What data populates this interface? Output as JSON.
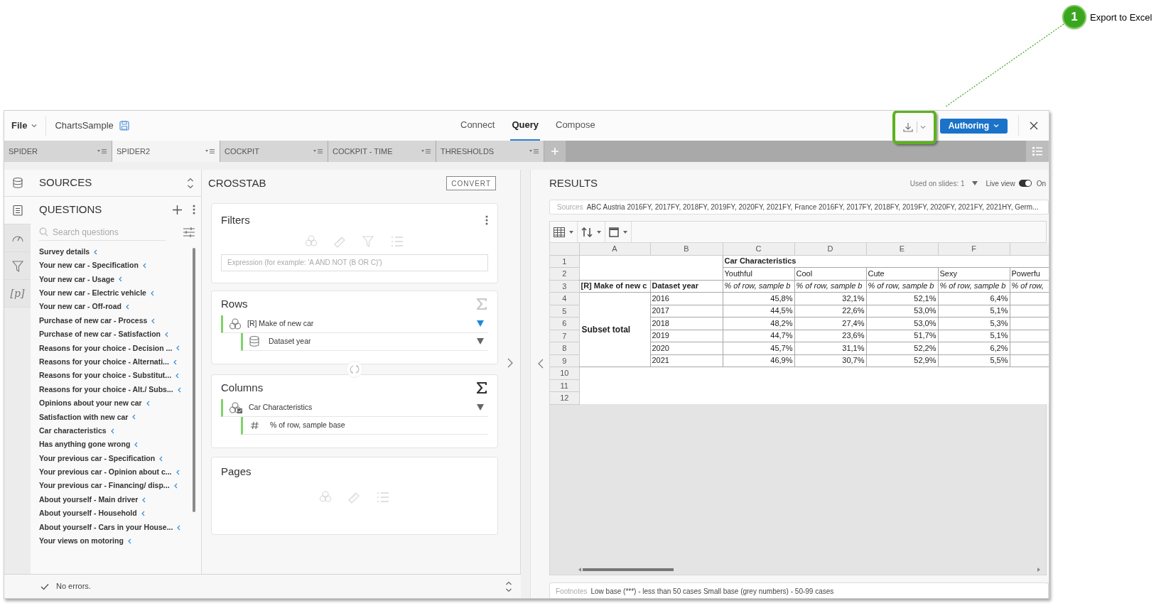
{
  "callout": {
    "number": "1",
    "label": "Export to Excel"
  },
  "toolbar": {
    "file_menu": "File",
    "document": "ChartsSample",
    "nav": [
      {
        "label": "Connect",
        "selected": false
      },
      {
        "label": "Query",
        "selected": true
      },
      {
        "label": "Compose",
        "selected": false
      }
    ],
    "mode_button": "Authoring"
  },
  "sheet_tabs": [
    {
      "label": "SPIDER",
      "selected": false
    },
    {
      "label": "SPIDER2",
      "selected": true
    },
    {
      "label": "COCKPIT",
      "selected": false
    },
    {
      "label": "COCKPIT - TIME",
      "selected": false
    },
    {
      "label": "THRESHOLDS",
      "selected": false
    }
  ],
  "sidebar": {
    "sources_title": "SOURCES",
    "rail": [
      {
        "kind": "questions",
        "selected": true
      },
      {
        "kind": "gauge",
        "selected": false
      },
      {
        "kind": "filter",
        "selected": false
      },
      {
        "kind": "parameter",
        "label": "[p]",
        "selected": false
      }
    ],
    "questions_title": "QUESTIONS",
    "search": {
      "placeholder": "Search questions"
    },
    "questions": [
      "Survey details",
      "Your new car - Specification",
      "Your new car - Usage",
      "Your new car - Electric vehicle",
      "Your new car - Off-road",
      "Purchase of new car - Process",
      "Purchase of new car - Satisfaction",
      "Reasons for your choice - Decision ...",
      "Reasons for your choice - Alternati...",
      "Reasons for your choice - Substitut...",
      "Reasons for your choice - Alt./ Subs...",
      "Opinions about your new car",
      "Satisfaction with new car",
      "Car characteristics",
      "Has anything gone wrong",
      "Your previous car - Specification",
      "Your previous car - Opinion about c...",
      "Your previous car - Financing/ disp...",
      "About yourself - Main driver",
      "About yourself - Household",
      "About yourself - Cars in your House...",
      "Your views on motoring"
    ]
  },
  "status_bar": "No errors.",
  "crosstab": {
    "title": "CROSSTAB",
    "convert_button": "CONVERT",
    "filters": {
      "title": "Filters",
      "placeholder": "Expression (for example: 'A AND NOT (B OR C)')"
    },
    "rows": {
      "title": "Rows",
      "sigma_active": false,
      "items": [
        {
          "label": "[R] Make of new car",
          "kind": "multi",
          "filtered": true,
          "children": [
            {
              "label": "Dataset year",
              "kind": "dataset",
              "filtered": false
            }
          ]
        }
      ]
    },
    "columns": {
      "title": "Columns",
      "sigma_active": true,
      "items": [
        {
          "label": "Car Characteristics",
          "kind": "grid",
          "filtered": false,
          "children": [
            {
              "label": "% of row, sample base",
              "kind": "measure"
            }
          ]
        }
      ]
    },
    "pages": {
      "title": "Pages"
    }
  },
  "results": {
    "title": "RESULTS",
    "used_on_slides": "Used on slides: 1",
    "live_view": {
      "label": "Live view",
      "on": true,
      "state_label": "On"
    },
    "sources": {
      "label": "Sources",
      "value": "ABC Austria 2016FY, 2017FY, 2018FY, 2019FY, 2020FY, 2021FY, France 2016FY, 2017FY, 2018FY, 2019FY, 2020FY, 2021FY, 2021HY, Germ..."
    },
    "grid": {
      "column_letters": [
        "A",
        "B",
        "C",
        "D",
        "E",
        "F"
      ],
      "row_numbers": [
        "1",
        "2",
        "3",
        "4",
        "5",
        "6",
        "7",
        "8",
        "9",
        "10",
        "11",
        "12"
      ],
      "banner": "Car Characteristics",
      "categories": [
        "Youthful",
        "Cool",
        "Cute",
        "Sexy",
        "Powerfu"
      ],
      "row_header_1": "[R] Make of new c",
      "row_header_2": "Dataset year",
      "measures": [
        "% of row, sample b",
        "% of row, sample b",
        "% of row, sample b",
        "% of row, sample b",
        "% of row,"
      ],
      "group_label": "Subset total",
      "rows": [
        {
          "year": "2016",
          "values": [
            "45,8%",
            "32,1%",
            "52,1%",
            "6,4%"
          ]
        },
        {
          "year": "2017",
          "values": [
            "44,5%",
            "22,6%",
            "53,0%",
            "5,1%"
          ]
        },
        {
          "year": "2018",
          "values": [
            "48,2%",
            "27,4%",
            "53,0%",
            "5,3%"
          ]
        },
        {
          "year": "2019",
          "values": [
            "44,7%",
            "23,6%",
            "51,7%",
            "5,1%"
          ]
        },
        {
          "year": "2020",
          "values": [
            "45,7%",
            "31,1%",
            "52,2%",
            "6,2%"
          ]
        },
        {
          "year": "2021",
          "values": [
            "46,9%",
            "30,7%",
            "52,9%",
            "5,5%"
          ]
        }
      ]
    },
    "footnotes": {
      "label": "Footnotes",
      "value": "Low base (***) - less than 50 cases Small base (grey numbers) - 50-99 cases"
    }
  }
}
